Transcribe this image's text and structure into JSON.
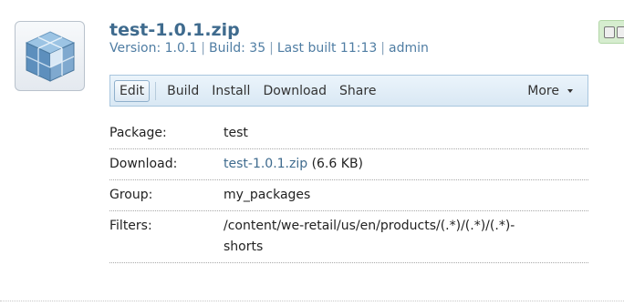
{
  "package": {
    "title": "test-1.0.1.zip",
    "version_text": "Version: 1.0.1",
    "build_text": "Build: 35",
    "last_built_text": "Last built 11:13",
    "user": "admin",
    "separator": "|",
    "icon": "package-cube-icon"
  },
  "toolbar": {
    "edit_label": "Edit",
    "build_label": "Build",
    "install_label": "Install",
    "download_label": "Download",
    "share_label": "Share",
    "more_label": "More",
    "more_icon": "chevron-down-icon"
  },
  "details": {
    "package_label": "Package:",
    "package_value": "test",
    "download_label": "Download:",
    "download_link": "test-1.0.1.zip",
    "download_size": "(6.6 KB)",
    "group_label": "Group:",
    "group_value": "my_packages",
    "filters_label": "Filters:",
    "filters_value_line1": "/content/we-retail/us/en/products/(.*)/(.*)/(.*)-",
    "filters_value_line2": "shorts"
  },
  "colors": {
    "title": "#3f6b8e",
    "meta": "#4f7da3",
    "toolbar_bg": "#dde9f4",
    "toolbar_border": "#a9c6de",
    "toggle_bg": "#d6edcf"
  }
}
